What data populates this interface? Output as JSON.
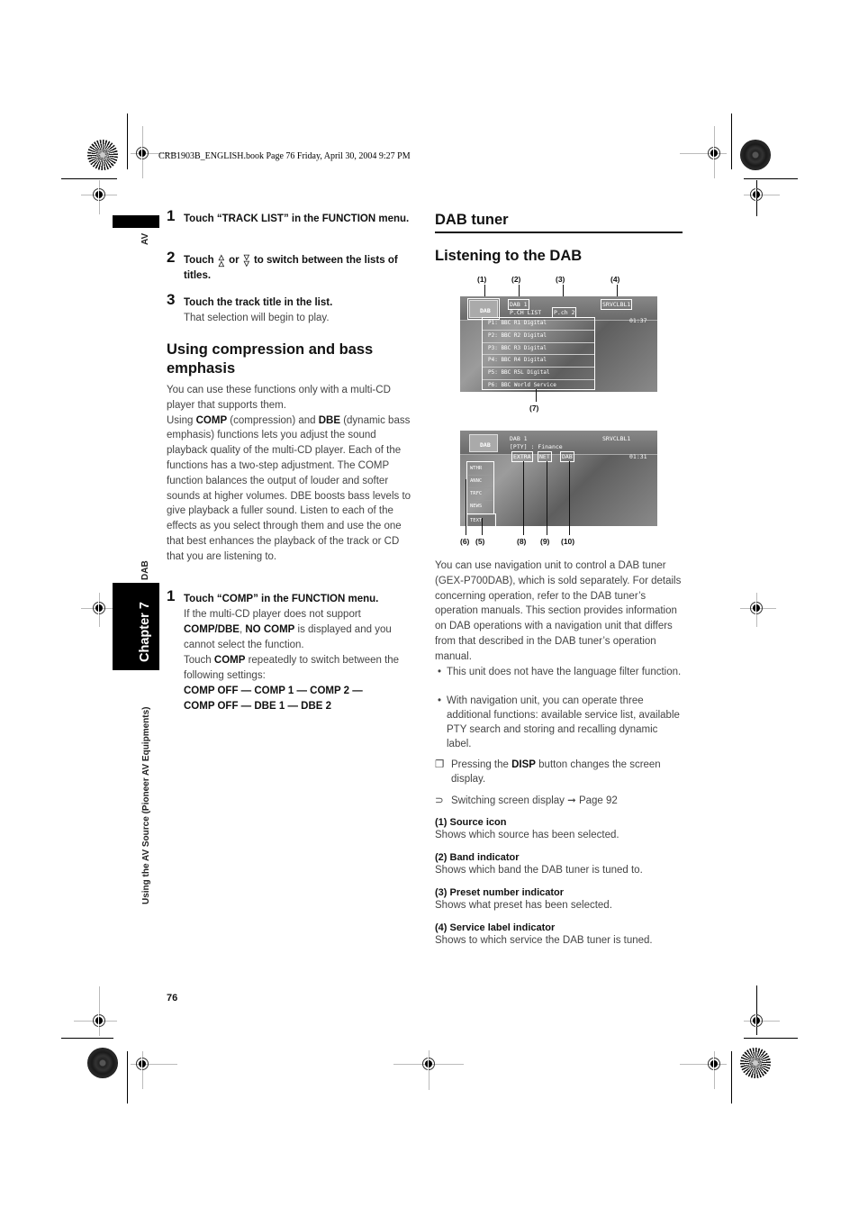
{
  "print_header": "CRB1903B_ENGLISH.book  Page 76  Friday, April 30, 2004  9:27 PM",
  "sidebar": {
    "top_label": "AV",
    "section_label": "DAB",
    "chapter_label": "Chapter 7",
    "chapter_title": "Using the AV Source (Pioneer AV Equipments)"
  },
  "page_number": "76",
  "left": {
    "steps_top": [
      {
        "num": "1",
        "title_parts": [
          "Touch “TRACK LIST” in the FUNCTION menu."
        ],
        "sub": ""
      },
      {
        "num": "2",
        "title_a": "Touch",
        "title_b": "or",
        "title_c": "to switch between the lists of titles.",
        "up_icon": "page-up-icon",
        "down_icon": "page-down-icon"
      },
      {
        "num": "3",
        "title": "Touch the track title in the list.",
        "sub": "That selection will begin to play."
      }
    ],
    "section_heading": "Using compression and bass emphasis",
    "intro": {
      "p1": "You can use these functions only with a multi-CD player that supports them.",
      "p2_a": "Using ",
      "p2_comp": "COMP",
      "p2_b": " (compression) and ",
      "p2_dbe": "DBE",
      "p2_c": " (dynamic bass emphasis) functions lets you adjust the sound playback quality of the multi-CD player. Each of the functions has a two-step adjustment. The COMP function balances the output of louder and softer sounds at higher volumes. DBE boosts bass levels to give playback a fuller sound. Listen to each of the effects as you select through them and use the one that best enhances the playback of the track or CD that you are listening to."
    },
    "comp_step": {
      "num": "1",
      "title": "Touch “COMP” in the FUNCTION menu.",
      "s1": "If the multi-CD player does not support ",
      "s1_bold": "COMP/DBE",
      "s1_sep": ", ",
      "s1_bold2": "NO COMP",
      "s1_end": " is displayed and you cannot select the function.",
      "s2": "Touch ",
      "s2_bold": "COMP",
      "s2_end": " repeatedly to switch between the following settings:",
      "seq1": "COMP OFF — COMP 1 — COMP 2 —",
      "seq2": "COMP OFF — DBE 1 — DBE 2"
    }
  },
  "right": {
    "title": "DAB tuner",
    "subtitle": "Listening to the DAB",
    "screen1": {
      "callouts_top": [
        "(1)",
        "(2)",
        "(3)",
        "(4)"
      ],
      "callout_bottom": "(7)",
      "source_icon_label": "DAB",
      "band": "DAB 1",
      "mode": "P.CH LIST",
      "preset_page": "P.ch 2",
      "service_label": "SRVCLBL1",
      "clock": "01:37",
      "list": [
        "P1: BBC  R1  Digital",
        "P2: BBC  R2  Digital",
        "P3: BBC  R3  Digital",
        "P4: BBC  R4  Digital",
        "P5: BBC  R5L  Digital",
        "P6: BBC World  Service"
      ]
    },
    "screen2": {
      "callouts_bottom": [
        "(6)",
        "(5)",
        "(8)",
        "(9)",
        "(10)"
      ],
      "source_icon_label": "DAB",
      "band": "DAB 1",
      "pty": "[PTY] : Finance",
      "service_label": "SRVCLBL1",
      "clock": "01:31",
      "buttons_top": [
        "EXTRA",
        "NET",
        "DAB"
      ],
      "side_buttons": [
        "WTHR",
        "ANNC",
        "TRFC",
        "NEWS"
      ],
      "text_button": "TEXT"
    },
    "intro": "You can use navigation unit to control a DAB tuner (GEX-P700DAB), which is sold separately. For details concerning operation, refer to the DAB tuner’s operation manuals. This section provides information on DAB operations with a navigation unit that differs from that described in the DAB tuner’s operation manual.",
    "bullets": [
      "This unit does not have the language filter function.",
      "With navigation unit, you can operate three additional functions: available service list, available PTY search and storing and recalling dynamic label."
    ],
    "note_a": "Pressing the ",
    "note_bold": "DISP",
    "note_b": " button changes the screen display.",
    "xref_text": "Switching screen display",
    "xref_page": "Page 92",
    "definitions": [
      {
        "title": "(1) Source icon",
        "text": "Shows which source has been selected."
      },
      {
        "title": "(2) Band indicator",
        "text": "Shows which band the DAB tuner is tuned to."
      },
      {
        "title": "(3) Preset number indicator",
        "text": "Shows what preset has been selected."
      },
      {
        "title": "(4) Service label indicator",
        "text": "Shows to which service the DAB tuner is tuned."
      }
    ]
  }
}
